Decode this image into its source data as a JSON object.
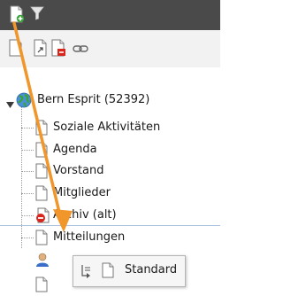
{
  "toolbar": {
    "new_page_icon": "new-page-icon",
    "filter_icon": "filter-icon",
    "page_icon": "page-icon",
    "page_link_icon": "page-link-icon",
    "page_delete_icon": "page-delete-icon",
    "link_icon": "chain-link-icon"
  },
  "tree": {
    "root": {
      "label": "Bern Esprit (52392)",
      "icon": "globe-icon",
      "expanded": true
    },
    "items": [
      {
        "label": "Soziale Aktivitäten",
        "icon": "page-icon"
      },
      {
        "label": "Agenda",
        "icon": "page-icon"
      },
      {
        "label": "Vorstand",
        "icon": "page-icon"
      },
      {
        "label": "Mitglieder",
        "icon": "page-icon"
      },
      {
        "label": "Archiv (alt)",
        "icon": "page-restricted-icon"
      },
      {
        "label": "Mitteilungen",
        "icon": "page-icon"
      }
    ]
  },
  "drag_popup": {
    "label": "Standard",
    "icon": "insert-after-icon"
  },
  "colors": {
    "toolbar_dark": "#4a4a4a",
    "toolbar_light": "#f2f2f2",
    "arrow": "#f0962a",
    "separator": "#a9c2df",
    "restricted_red": "#d9261c"
  }
}
